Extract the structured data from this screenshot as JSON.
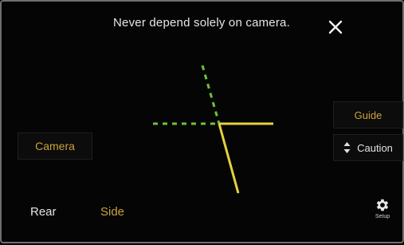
{
  "warning": {
    "text": "Never depend solely on camera."
  },
  "buttons": {
    "camera": "Camera",
    "guide": "Guide",
    "caution": "Caution"
  },
  "tabs": {
    "rear": "Rear",
    "side": "Side"
  },
  "setup": {
    "label": "Setup"
  },
  "colors": {
    "accent": "#c9a33a",
    "guide_line_solid": "#e3d23a",
    "guide_line_dashed": "#6dc23a",
    "text": "#e6e6e6"
  },
  "icons": {
    "close": "close-icon",
    "caution": "updown-arrows-icon",
    "setup": "gear-icon"
  }
}
